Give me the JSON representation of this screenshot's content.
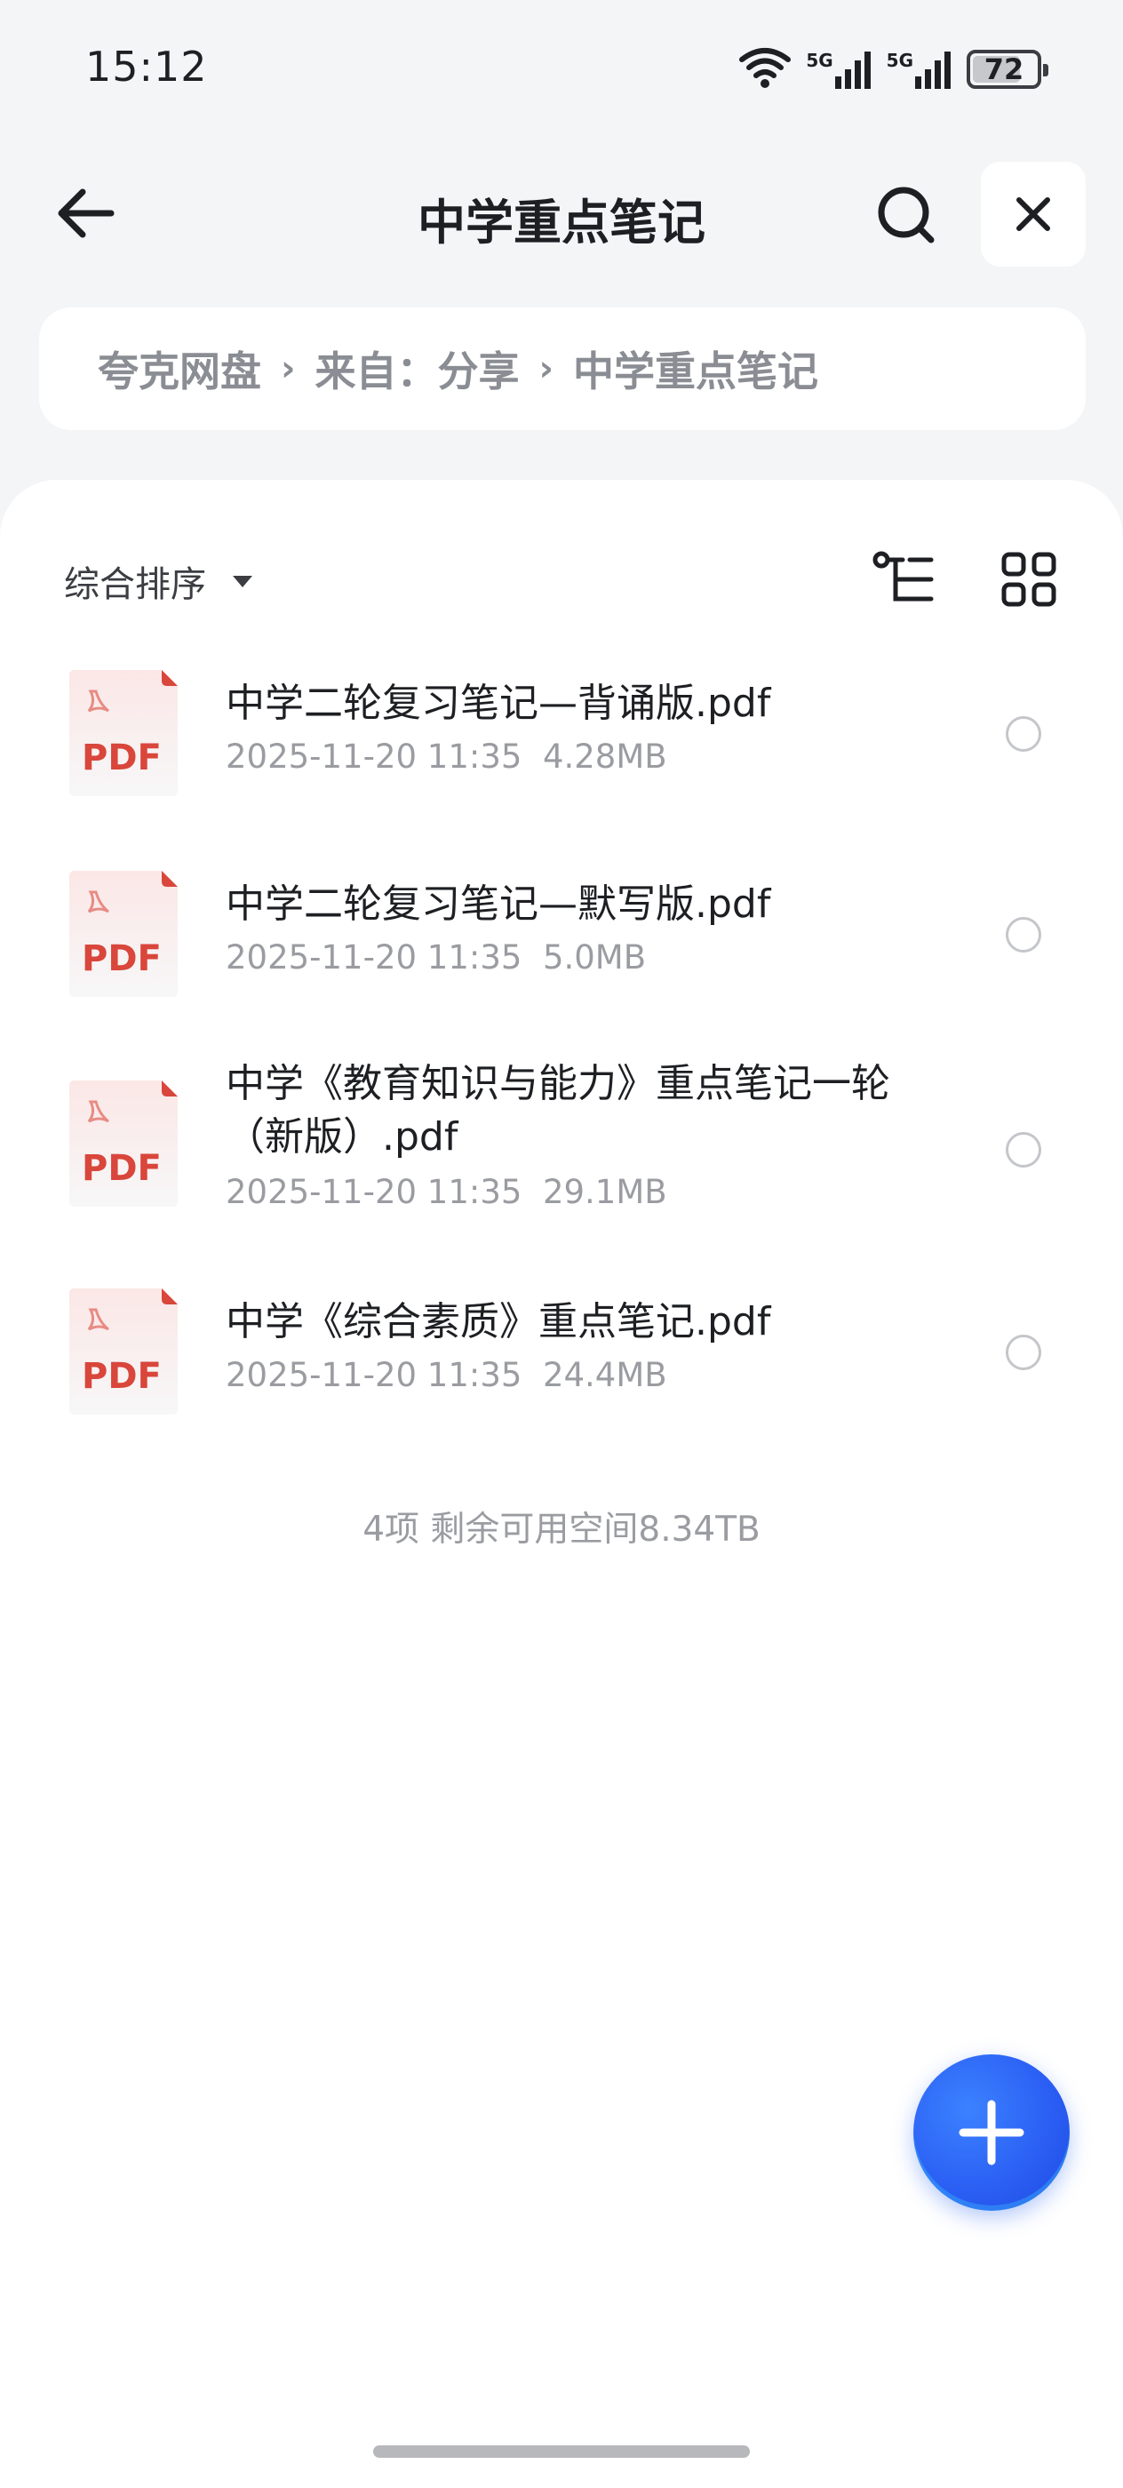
{
  "status_bar": {
    "time": "15:12",
    "network1": "5G",
    "network2": "5G",
    "battery": "72",
    "battery_level_percent": 72
  },
  "header": {
    "title": "中学重点笔记",
    "back_icon": "arrow-left-icon",
    "search_icon": "search-icon",
    "close_icon": "close-icon"
  },
  "breadcrumb": {
    "items": [
      "夸克网盘",
      "来自：分享",
      "中学重点笔记"
    ],
    "separator": "›"
  },
  "toolbar": {
    "sort_label": "综合排序",
    "tree_icon": "tree-view-icon",
    "grid_icon": "grid-view-icon"
  },
  "files": [
    {
      "name": "中学二轮复习笔记—背诵版.pdf",
      "date": "2025-11-20 11:35",
      "size": "4.28MB",
      "type": "PDF"
    },
    {
      "name": "中学二轮复习笔记—默写版.pdf",
      "date": "2025-11-20 11:35",
      "size": "5.0MB",
      "type": "PDF"
    },
    {
      "name": "中学《教育知识与能力》重点笔记一轮（新版）.pdf",
      "date": "2025-11-20 11:35",
      "size": "29.1MB",
      "type": "PDF"
    },
    {
      "name": "中学《综合素质》重点笔记.pdf",
      "date": "2025-11-20 11:35",
      "size": "24.4MB",
      "type": "PDF"
    }
  ],
  "summary": "4项 剩余可用空间8.34TB",
  "fab_icon": "plus-icon",
  "colors": {
    "accent": "#2a5df3",
    "pdf_red": "#d9463b",
    "background": "#f4f5f7"
  }
}
